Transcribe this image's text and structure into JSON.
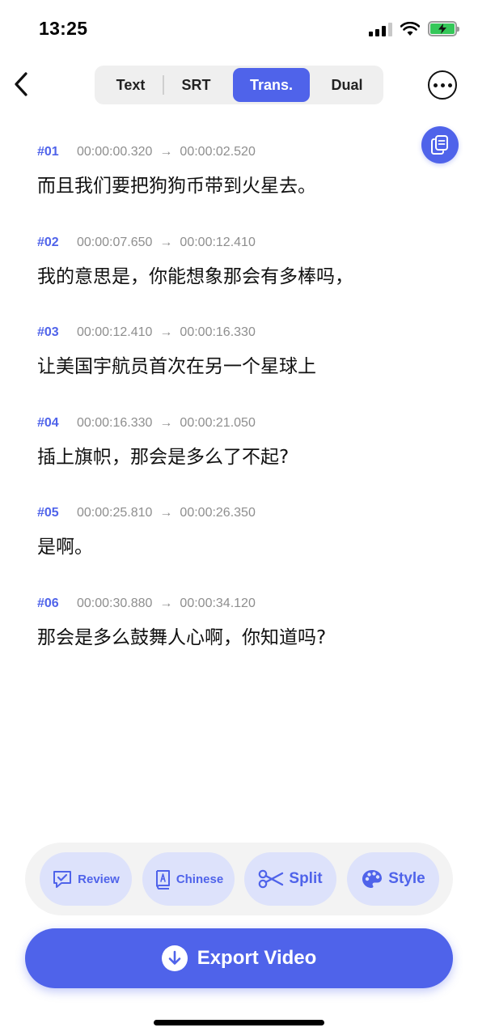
{
  "status": {
    "time": "13:25"
  },
  "header": {
    "tabs": [
      {
        "label": "Text"
      },
      {
        "label": "SRT"
      },
      {
        "label": "Trans."
      },
      {
        "label": "Dual"
      }
    ],
    "active_tab": "Trans."
  },
  "subtitles": [
    {
      "index": "#01",
      "start": "00:00:00.320",
      "end": "00:00:02.520",
      "text": "而且我们要把狗狗币带到火星去。"
    },
    {
      "index": "#02",
      "start": "00:00:07.650",
      "end": "00:00:12.410",
      "text": "我的意思是，你能想象那会有多棒吗，"
    },
    {
      "index": "#03",
      "start": "00:00:12.410",
      "end": "00:00:16.330",
      "text": "让美国宇航员首次在另一个星球上"
    },
    {
      "index": "#04",
      "start": "00:00:16.330",
      "end": "00:00:21.050",
      "text": "插上旗帜，那会是多么了不起?"
    },
    {
      "index": "#05",
      "start": "00:00:25.810",
      "end": "00:00:26.350",
      "text": "是啊。"
    },
    {
      "index": "#06",
      "start": "00:00:30.880",
      "end": "00:00:34.120",
      "text": "那会是多么鼓舞人心啊，你知道吗?"
    }
  ],
  "arrow_glyph": "→",
  "toolbar": {
    "review_label": "Review",
    "chinese_label": "Chinese",
    "split_label": "Split",
    "style_label": "Style"
  },
  "export_label": "Export Video",
  "colors": {
    "accent": "#4f63ea",
    "accent_light": "#dde2fb",
    "battery_green": "#35c759"
  },
  "icons": {
    "back": "chevron-left-icon",
    "more": "more-icon",
    "copy": "copy-icon",
    "review": "review-icon",
    "chinese": "book-icon",
    "split": "scissors-icon",
    "style": "palette-icon",
    "export": "download-icon"
  }
}
